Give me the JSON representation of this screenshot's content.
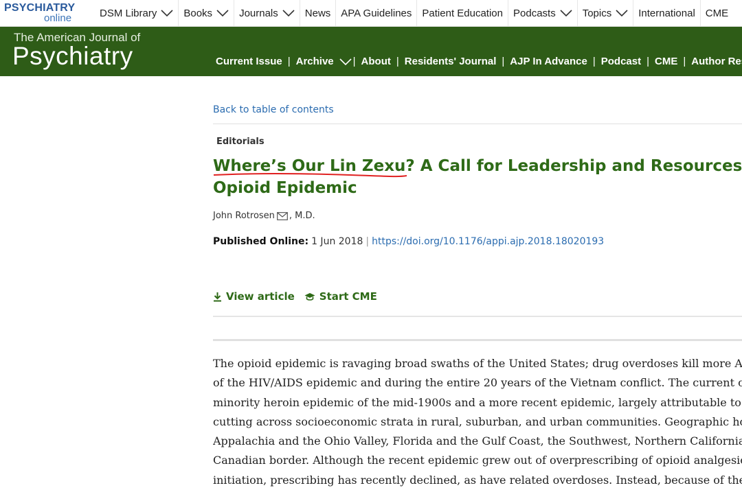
{
  "topnav": {
    "logo_main": "PSYCHIATRY",
    "logo_sub": "online",
    "items": [
      {
        "label": "DSM Library",
        "dropdown": true
      },
      {
        "label": "Books",
        "dropdown": true
      },
      {
        "label": "Journals",
        "dropdown": true
      },
      {
        "label": "News",
        "dropdown": false
      },
      {
        "label": "APA Guidelines",
        "dropdown": false
      },
      {
        "label": "Patient Education",
        "dropdown": false
      },
      {
        "label": "Podcasts",
        "dropdown": true
      },
      {
        "label": "Topics",
        "dropdown": true
      },
      {
        "label": "International",
        "dropdown": false
      },
      {
        "label": "CME",
        "dropdown": false
      }
    ]
  },
  "journal": {
    "small_title": "The American Journal of",
    "big_title": "Psychiatry",
    "nav": [
      {
        "label": "Current Issue",
        "dropdown": false
      },
      {
        "label": "Archive",
        "dropdown": true
      },
      {
        "label": "About",
        "dropdown": false
      },
      {
        "label": "Residents' Journal",
        "dropdown": false
      },
      {
        "label": "AJP In Advance",
        "dropdown": false
      },
      {
        "label": "Podcast",
        "dropdown": false
      },
      {
        "label": "CME",
        "dropdown": false
      },
      {
        "label": "Author Resources",
        "dropdown": false
      }
    ],
    "brand_color": "#2e5c17"
  },
  "article": {
    "back_link": "Back to table of contents",
    "section": "Editorials",
    "title_line1": "Where’s Our Lin Zexu? A Call for Leadership and Resources",
    "title_line2": "Opioid Epidemic",
    "author_name": "John Rotrosen",
    "author_suffix": ", M.D.",
    "published_label": "Published Online:",
    "published_date": "1 Jun 2018",
    "doi": "https://doi.org/10.1176/appi.ajp.2018.18020193",
    "actions": {
      "view_article": "View article",
      "start_cme": "Start CME"
    },
    "body_lines": [
      "The opioid epidemic is ravaging broad swaths of the United States; drug overdoses kill more Americans",
      "of the HIV/AIDS epidemic and during the entire 20 years of the Vietnam conflict. The current crisis is",
      "minority heroin epidemic of the mid-1900s and a more recent epidemic, largely attributable to opioid",
      "cutting across socioeconomic strata in rural, suburban, and urban communities. Geographic hot spots",
      "Appalachia and the Ohio Valley, Florida and the Gulf Coast, the Southwest, Northern California and th",
      "Canadian border. Although the recent epidemic grew out of overprescribing of opioid analgesics, and",
      "initiation, prescribing has recently declined, as have related overdoses. Instead, because of the scarcit"
    ],
    "title_color": "#2e6a17",
    "link_color": "#2b6cb0"
  }
}
